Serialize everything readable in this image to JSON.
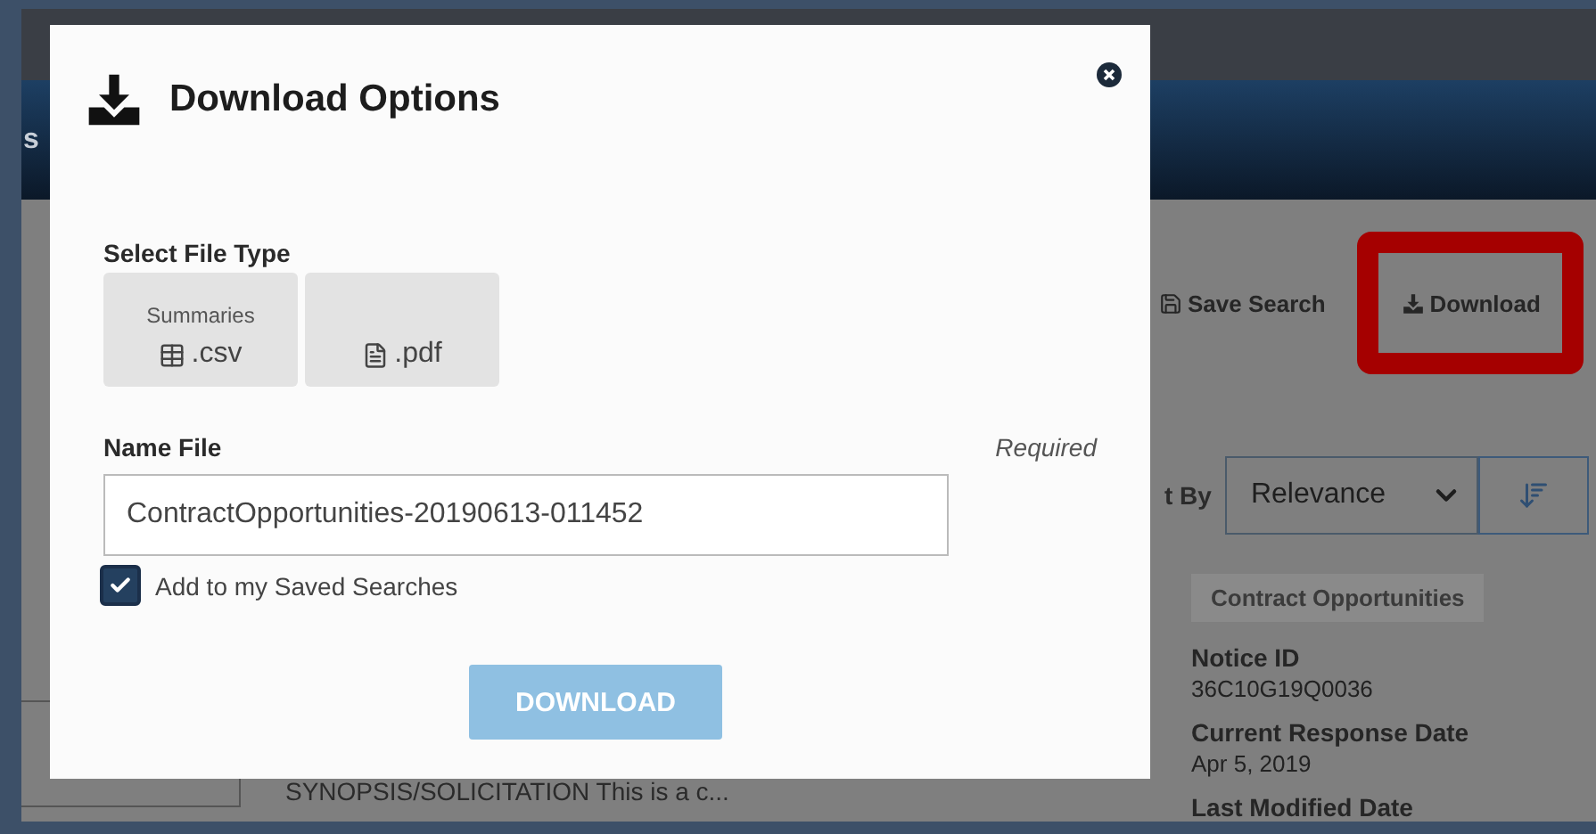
{
  "background": {
    "header_fragment": "s",
    "toolbar": [
      {
        "label": "Save Search",
        "kind": "save",
        "highlighted": false
      },
      {
        "label": "Download",
        "kind": "download",
        "highlighted": true
      }
    ],
    "sort": {
      "label": "t By",
      "value": "Relevance"
    },
    "result": {
      "tag": "Contract Opportunities",
      "fields": [
        {
          "label": "Notice ID",
          "value": "36C10G19Q0036"
        },
        {
          "label": "Current Response Date",
          "value": "Apr 5, 2019"
        },
        {
          "label": "Last Modified Date"
        }
      ],
      "description": "SYNOPSIS/SOLICITATION This is a c..."
    }
  },
  "dialog": {
    "title": "Download Options",
    "file_type": {
      "label": "Select File Type",
      "options": [
        {
          "caption": "Summaries",
          "label": ".csv",
          "kind": "csv"
        },
        {
          "label": ".pdf",
          "kind": "pdf"
        }
      ]
    },
    "name_file": {
      "label": "Name File",
      "hint": "Required",
      "value": "ContractOpportunities-20190613-011452"
    },
    "save_search": {
      "label": "Add to my Saved Searches",
      "checked": true
    },
    "button": {
      "label": "DOWNLOAD",
      "disabled": true
    }
  }
}
